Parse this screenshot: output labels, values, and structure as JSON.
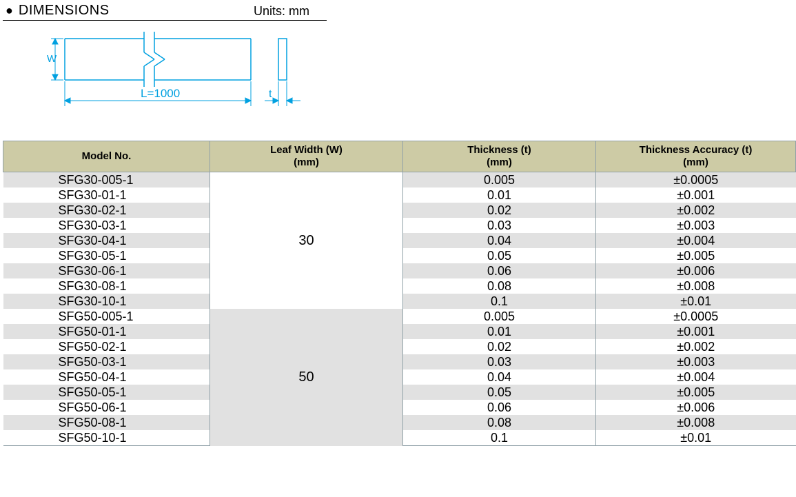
{
  "header": {
    "title": "DIMENSIONS",
    "units_label": "Units: mm"
  },
  "diagram": {
    "w_label": "W",
    "l_label": "L=1000",
    "t_label": "t"
  },
  "table": {
    "headers": {
      "model": "Model No.",
      "width": "Leaf Width (W)\n(mm)",
      "thickness": "Thickness (t)\n(mm)",
      "accuracy": "Thickness Accuracy (t)\n(mm)"
    },
    "groups": [
      {
        "width": "30",
        "rows": [
          {
            "model": "SFG30-005-1",
            "thickness": "0.005",
            "accuracy": "±0.0005"
          },
          {
            "model": "SFG30-01-1",
            "thickness": "0.01",
            "accuracy": "±0.001"
          },
          {
            "model": "SFG30-02-1",
            "thickness": "0.02",
            "accuracy": "±0.002"
          },
          {
            "model": "SFG30-03-1",
            "thickness": "0.03",
            "accuracy": "±0.003"
          },
          {
            "model": "SFG30-04-1",
            "thickness": "0.04",
            "accuracy": "±0.004"
          },
          {
            "model": "SFG30-05-1",
            "thickness": "0.05",
            "accuracy": "±0.005"
          },
          {
            "model": "SFG30-06-1",
            "thickness": "0.06",
            "accuracy": "±0.006"
          },
          {
            "model": "SFG30-08-1",
            "thickness": "0.08",
            "accuracy": "±0.008"
          },
          {
            "model": "SFG30-10-1",
            "thickness": "0.1",
            "accuracy": "±0.01"
          }
        ]
      },
      {
        "width": "50",
        "rows": [
          {
            "model": "SFG50-005-1",
            "thickness": "0.005",
            "accuracy": "±0.0005"
          },
          {
            "model": "SFG50-01-1",
            "thickness": "0.01",
            "accuracy": "±0.001"
          },
          {
            "model": "SFG50-02-1",
            "thickness": "0.02",
            "accuracy": "±0.002"
          },
          {
            "model": "SFG50-03-1",
            "thickness": "0.03",
            "accuracy": "±0.003"
          },
          {
            "model": "SFG50-04-1",
            "thickness": "0.04",
            "accuracy": "±0.004"
          },
          {
            "model": "SFG50-05-1",
            "thickness": "0.05",
            "accuracy": "±0.005"
          },
          {
            "model": "SFG50-06-1",
            "thickness": "0.06",
            "accuracy": "±0.006"
          },
          {
            "model": "SFG50-08-1",
            "thickness": "0.08",
            "accuracy": "±0.008"
          },
          {
            "model": "SFG50-10-1",
            "thickness": "0.1",
            "accuracy": "±0.01"
          }
        ]
      }
    ]
  }
}
